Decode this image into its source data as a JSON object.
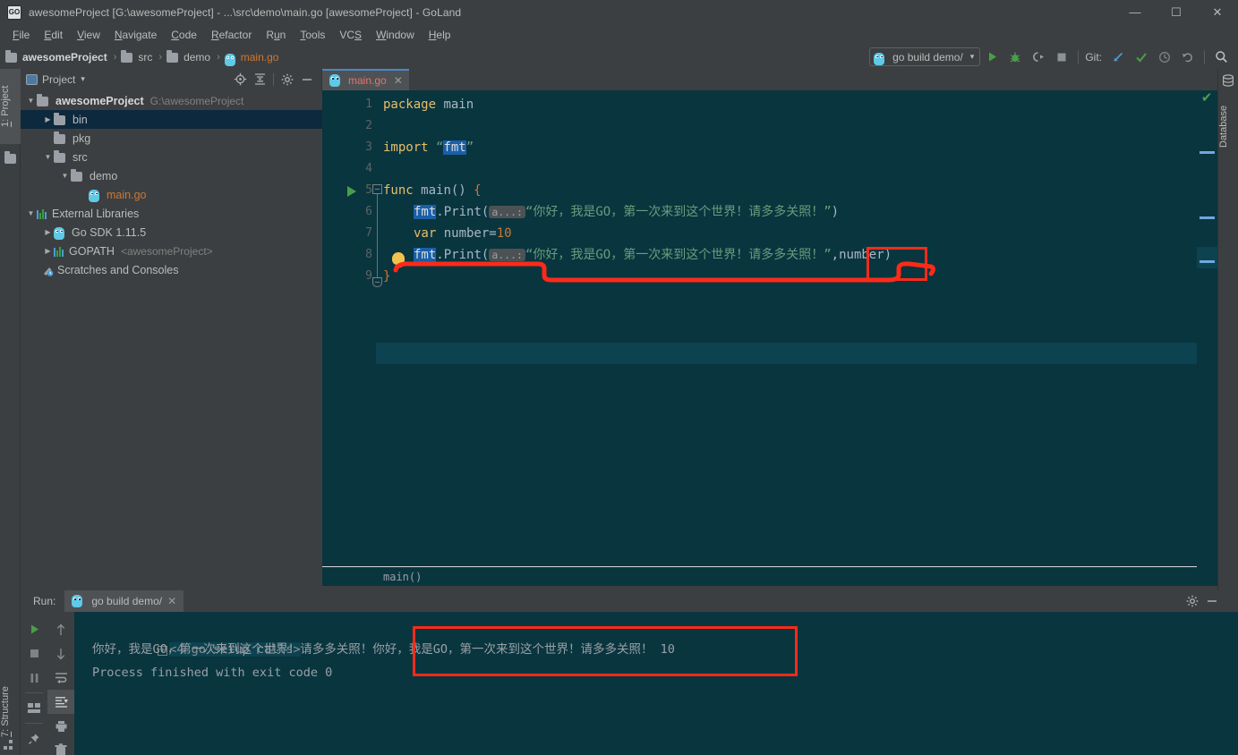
{
  "window": {
    "title": "awesomeProject [G:\\awesomeProject] - ...\\src\\demo\\main.go [awesomeProject] - GoLand",
    "app_icon_text": "GO",
    "minimize": "—",
    "maximize": "☐",
    "close": "✕"
  },
  "menubar": {
    "items": [
      {
        "mnemonic": "F",
        "rest": "ile"
      },
      {
        "mnemonic": "E",
        "rest": "dit"
      },
      {
        "mnemonic": "V",
        "rest": "iew"
      },
      {
        "mnemonic": "N",
        "rest": "avigate"
      },
      {
        "mnemonic": "C",
        "rest": "ode"
      },
      {
        "mnemonic": "R",
        "rest": "efactor"
      },
      {
        "mnemonic": "R",
        "rest": "un",
        "pre": "R",
        "post": "un"
      },
      {
        "mnemonic": "T",
        "rest": "ools"
      },
      {
        "mnemonic": "V",
        "rest": "CS"
      },
      {
        "mnemonic": "W",
        "rest": "indow"
      },
      {
        "mnemonic": "H",
        "rest": "elp"
      }
    ],
    "labels": [
      "File",
      "Edit",
      "View",
      "Navigate",
      "Code",
      "Refactor",
      "Run",
      "Tools",
      "VCS",
      "Window",
      "Help"
    ]
  },
  "navbar": {
    "breadcrumbs": [
      "awesomeProject",
      "src",
      "demo",
      "main.go"
    ],
    "separator": "›",
    "run_config": "go build demo/",
    "run_config_caret": "▾",
    "git_label": "Git:",
    "actions": [
      "run-icon",
      "debug-icon",
      "run-coverage-icon",
      "stop-icon"
    ],
    "git_actions": [
      "update-project-icon",
      "commit-icon",
      "history-icon",
      "rollback-icon"
    ],
    "search_icon": "search-icon"
  },
  "left_strip": {
    "project_tab": {
      "number": "1",
      "label": "Project"
    },
    "structure_tab": {
      "number": "7",
      "label": "Structure"
    }
  },
  "right_strip": {
    "database_tab": "Database"
  },
  "project_panel": {
    "title": "Project",
    "caret": "▾",
    "actions": [
      "locate-icon",
      "collapse-all-icon",
      "settings-gear-icon",
      "hide-icon"
    ],
    "tree": [
      {
        "indent": 0,
        "arrow": "▼",
        "icon": "folder-icon",
        "label": "awesomeProject",
        "bold": true,
        "path": "G:\\awesomeProject",
        "selected": false
      },
      {
        "indent": 1,
        "arrow": "▶",
        "icon": "folder-icon",
        "label": "bin",
        "bold": false,
        "path": "",
        "selected": true
      },
      {
        "indent": 1,
        "arrow": "",
        "icon": "folder-icon",
        "label": "pkg",
        "bold": false,
        "path": "",
        "selected": false
      },
      {
        "indent": 1,
        "arrow": "▼",
        "icon": "folder-icon",
        "label": "src",
        "bold": false,
        "path": "",
        "selected": false
      },
      {
        "indent": 2,
        "arrow": "▼",
        "icon": "folder-icon",
        "label": "demo",
        "bold": false,
        "path": "",
        "selected": false
      },
      {
        "indent": 3,
        "arrow": "",
        "icon": "go-file-icon",
        "label": "main.go",
        "bold": false,
        "path": "",
        "selected": false,
        "go": true
      },
      {
        "indent": 0,
        "arrow": "▼",
        "icon": "library-icon",
        "label": "External Libraries",
        "bold": false,
        "path": "",
        "selected": false
      },
      {
        "indent": 1,
        "arrow": "▶",
        "icon": "go-sdk-icon",
        "label": "Go SDK 1.11.5",
        "bold": false,
        "path": "",
        "selected": false
      },
      {
        "indent": 1,
        "arrow": "▶",
        "icon": "library-icon",
        "label": "GOPATH",
        "bold": false,
        "path": "<awesomeProject>",
        "selected": false
      },
      {
        "indent": 0,
        "arrow": "",
        "icon": "scratches-icon",
        "label": "Scratches and Consoles",
        "bold": false,
        "path": "",
        "selected": false
      }
    ]
  },
  "editor": {
    "tab": {
      "label": "main.go",
      "close": "✕",
      "icon": "go-file-icon"
    },
    "breadcrumb": "main()",
    "line_numbers": [
      "1",
      "2",
      "3",
      "4",
      "5",
      "6",
      "7",
      "8",
      "9"
    ],
    "code_lines": [
      {
        "n": 1,
        "segments": [
          {
            "t": "package ",
            "c": "kw2"
          },
          {
            "t": "main",
            "c": "ident"
          }
        ]
      },
      {
        "n": 2,
        "segments": []
      },
      {
        "n": 3,
        "segments": [
          {
            "t": "import ",
            "c": "kw2"
          },
          {
            "t": "“",
            "c": "str"
          },
          {
            "t": "fmt",
            "c": "hl"
          },
          {
            "t": "”",
            "c": "str"
          }
        ]
      },
      {
        "n": 5,
        "segments": [
          {
            "t": "func ",
            "c": "kw2"
          },
          {
            "t": "main() ",
            "c": "ident"
          },
          {
            "t": "{",
            "c": "kw"
          }
        ]
      },
      {
        "n": 6,
        "segments": [
          {
            "t": "fmt",
            "c": "hl"
          },
          {
            "t": ".Print(",
            "c": "ident"
          },
          {
            "t": "a...:",
            "c": "phint"
          },
          {
            "t": "“你好，我是GO，第一次来到这个世界！请多多关照！”",
            "c": "str"
          },
          {
            "t": ")",
            "c": "ident"
          }
        ]
      },
      {
        "n": 7,
        "segments": [
          {
            "t": "var ",
            "c": "kw2"
          },
          {
            "t": "number=",
            "c": "ident"
          },
          {
            "t": "10",
            "c": "num"
          }
        ]
      },
      {
        "n": 8,
        "segments": [
          {
            "t": "fmt",
            "c": "hl"
          },
          {
            "t": ".Print(",
            "c": "ident"
          },
          {
            "t": "a...:",
            "c": "phint"
          },
          {
            "t": "“你好，我是GO，第一次来到这个世界！请多多关照！”",
            "c": "str"
          },
          {
            "t": ",number)",
            "c": "ident"
          }
        ]
      },
      {
        "n": 9,
        "segments": [
          {
            "t": "}",
            "c": "kw"
          }
        ]
      }
    ],
    "raw_text": {
      "l1": "package main",
      "l3": "import “fmt”",
      "l5": "func main() {",
      "l6": "fmt.Print(a...:“你好，我是GO，第一次来到这个世界！请多多关照！”)",
      "l7": "var number=10",
      "l8": "fmt.Print(a...:“你好，我是GO，第一次来到这个世界！请多多关照！”,number)",
      "l9": "}"
    },
    "inspection_status": "✔",
    "gutter_icons": [
      "run-gutter-icon",
      "intention-bulb-icon",
      "fold-icon"
    ]
  },
  "run_panel": {
    "label": "Run:",
    "tab": {
      "label": "go build demo/",
      "close": "✕",
      "icon": "go-file-icon"
    },
    "actions": [
      "settings-gear-icon",
      "hide-icon"
    ],
    "side_actions": [
      "rerun-icon",
      "stop-icon",
      "pause-icon",
      "layout-icon",
      "pin-icon"
    ],
    "side_actions2": [
      "up-icon",
      "down-icon",
      "soft-wrap-icon",
      "scroll-to-end-icon",
      "print-icon",
      "clear-all-icon"
    ],
    "console": {
      "fold_label": "<4 go setup calls>",
      "fold_marker": "+",
      "output_line": "你好，我是GO，第一次来到这个世界！请多多关照！你好，我是GO，第一次来到这个世界！请多多关照！ 10",
      "output_part1": "你好，我是GO，第一次来到这个世界！请多多关照！",
      "output_part2": "你好，我是GO，第一次来到这个世界！请多多关照！ 10",
      "exit_line": "Process finished with exit code 0"
    }
  },
  "annotations": {
    "color": "#fc2a19",
    "box_number_target": "number)",
    "box_output_target": "你好，我是GO，第一次来到这个世界！请多多关照！ 10"
  },
  "colors": {
    "chrome": "#3c3f41",
    "editor_bg": "#09353f",
    "accent_blue": "#4a88c7",
    "annotation_red": "#fc2a19",
    "go_orange": "#cc7832",
    "string_green": "#6a9b7b",
    "selection_blue": "#1a5fa8"
  }
}
